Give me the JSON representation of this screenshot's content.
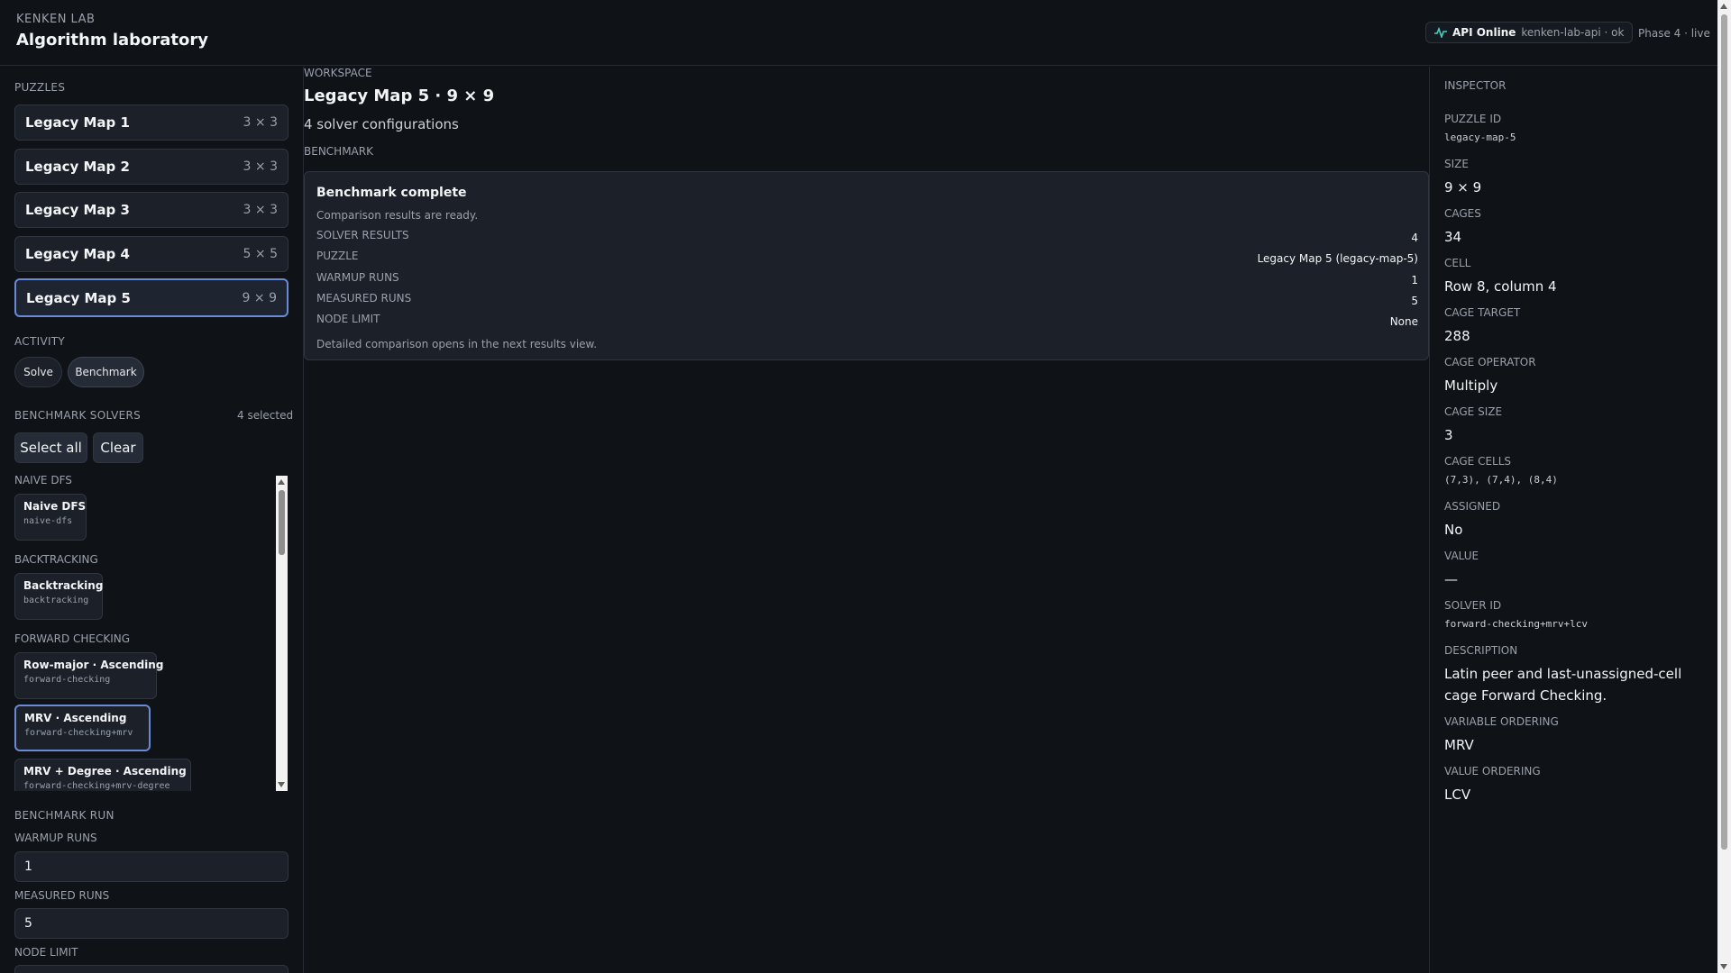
{
  "header": {
    "brand_small": "KENKEN LAB",
    "brand_title": "Algorithm laboratory",
    "api_label": "API Online",
    "api_sub": "kenken-lab-api · ok",
    "api_icon": "activity-pulse-icon",
    "phase": "Phase 4 · live",
    "accent_color": "#4ecdc4"
  },
  "left": {
    "puzzles_label": "PUZZLES",
    "puzzles": [
      {
        "name": "Legacy Map 1",
        "size": "3 × 3"
      },
      {
        "name": "Legacy Map 2",
        "size": "3 × 3"
      },
      {
        "name": "Legacy Map 3",
        "size": "3 × 3"
      },
      {
        "name": "Legacy Map 4",
        "size": "5 × 5"
      },
      {
        "name": "Legacy Map 5",
        "size": "9 × 9"
      }
    ],
    "active_puzzle": "Legacy Map 5",
    "activity_label": "ACTIVITY",
    "activity": {
      "solve": "Solve",
      "benchmark": "Benchmark",
      "active": "Benchmark"
    },
    "bench_solvers_label": "BENCHMARK SOLVERS",
    "selected_count": "4 selected",
    "select_all": "Select all",
    "clear": "Clear",
    "groups": [
      {
        "label": "NAIVE DFS",
        "solvers": [
          {
            "name": "Naive DFS",
            "id": "naive-dfs"
          }
        ]
      },
      {
        "label": "BACKTRACKING",
        "solvers": [
          {
            "name": "Backtracking",
            "id": "backtracking"
          }
        ]
      },
      {
        "label": "FORWARD CHECKING",
        "solvers": [
          {
            "name": "Row-major · Ascending",
            "id": "forward-checking"
          },
          {
            "name": "MRV · Ascending",
            "id": "forward-checking+mrv"
          },
          {
            "name": "MRV + Degree · Ascending",
            "id": "forward-checking+mrv-degree"
          }
        ]
      }
    ],
    "bench_run_label": "BENCHMARK RUN",
    "warmup_label": "WARMUP RUNS",
    "warmup_value": "1",
    "measured_label": "MEASURED RUNS",
    "measured_value": "5",
    "node_limit_label": "NODE LIMIT"
  },
  "workspace": {
    "label": "WORKSPACE",
    "title": "Legacy Map 5 · 9 × 9",
    "subtitle": "4 solver configurations",
    "bench_label": "BENCHMARK",
    "card": {
      "title": "Benchmark complete",
      "subtitle": "Comparison results are ready.",
      "rows": [
        {
          "k": "SOLVER RESULTS",
          "v": "4"
        },
        {
          "k": "PUZZLE",
          "v": "Legacy Map 5 (legacy-map-5)"
        },
        {
          "k": "WARMUP RUNS",
          "v": "1"
        },
        {
          "k": "MEASURED RUNS",
          "v": "5"
        },
        {
          "k": "NODE LIMIT",
          "v": "None"
        }
      ],
      "footer": "Detailed comparison opens in the next results view."
    }
  },
  "inspector": {
    "title": "INSPECTOR",
    "fields": [
      {
        "k": "PUZZLE ID",
        "v": "legacy-map-5",
        "mono": true
      },
      {
        "k": "SIZE",
        "v": "9 × 9"
      },
      {
        "k": "CAGES",
        "v": "34"
      },
      {
        "k": "CELL",
        "v": "Row 8, column 4"
      },
      {
        "k": "CAGE TARGET",
        "v": "288"
      },
      {
        "k": "CAGE OPERATOR",
        "v": "Multiply"
      },
      {
        "k": "CAGE SIZE",
        "v": "3"
      },
      {
        "k": "CAGE CELLS",
        "v": "(7,3), (7,4), (8,4)",
        "mono": true
      },
      {
        "k": "ASSIGNED",
        "v": "No"
      },
      {
        "k": "VALUE",
        "v": "—"
      },
      {
        "k": "SOLVER ID",
        "v": "forward-checking+mrv+lcv",
        "mono": true
      },
      {
        "k": "DESCRIPTION",
        "v": "Latin peer and last-unassigned-cell cage Forward Checking."
      },
      {
        "k": "VARIABLE ORDERING",
        "v": "MRV"
      },
      {
        "k": "VALUE ORDERING",
        "v": "LCV"
      }
    ]
  }
}
